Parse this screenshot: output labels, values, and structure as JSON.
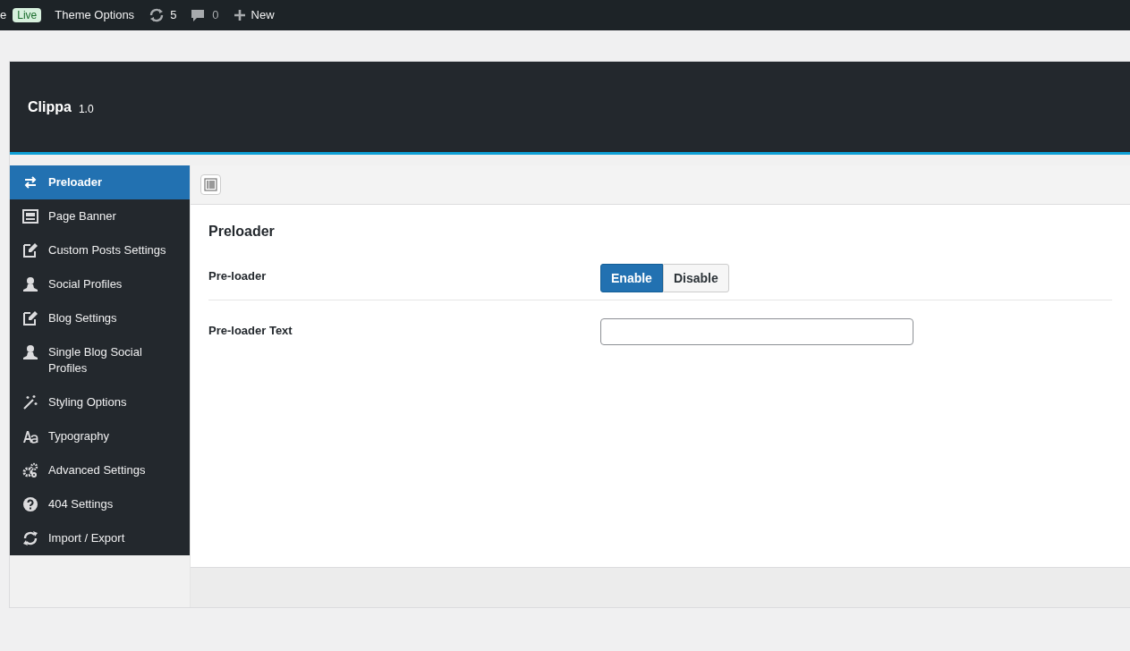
{
  "admin_bar": {
    "site_fragment": "e",
    "live_badge": "Live",
    "theme_options": "Theme Options",
    "updates": "5",
    "comments": "0",
    "new": "New"
  },
  "header": {
    "title": "Clippa",
    "version": "1.0"
  },
  "sidebar": {
    "items": [
      {
        "label": "Preloader",
        "selected": true
      },
      {
        "label": "Page Banner",
        "selected": false
      },
      {
        "label": "Custom Posts Settings",
        "selected": false
      },
      {
        "label": "Social Profiles",
        "selected": false
      },
      {
        "label": "Blog Settings",
        "selected": false
      },
      {
        "label": "Single Blog Social Profiles",
        "selected": false
      },
      {
        "label": "Styling Options",
        "selected": false
      },
      {
        "label": "Typography",
        "selected": false
      },
      {
        "label": "Advanced Settings",
        "selected": false
      },
      {
        "label": "404 Settings",
        "selected": false
      },
      {
        "label": "Import / Export",
        "selected": false
      }
    ]
  },
  "section": {
    "title": "Preloader",
    "fields": [
      {
        "kind": "switch",
        "label": "Pre-loader",
        "options": [
          {
            "label": "Enable",
            "selected": true
          },
          {
            "label": "Disable",
            "selected": false
          }
        ]
      },
      {
        "kind": "text",
        "label": "Pre-loader Text"
      }
    ]
  }
}
